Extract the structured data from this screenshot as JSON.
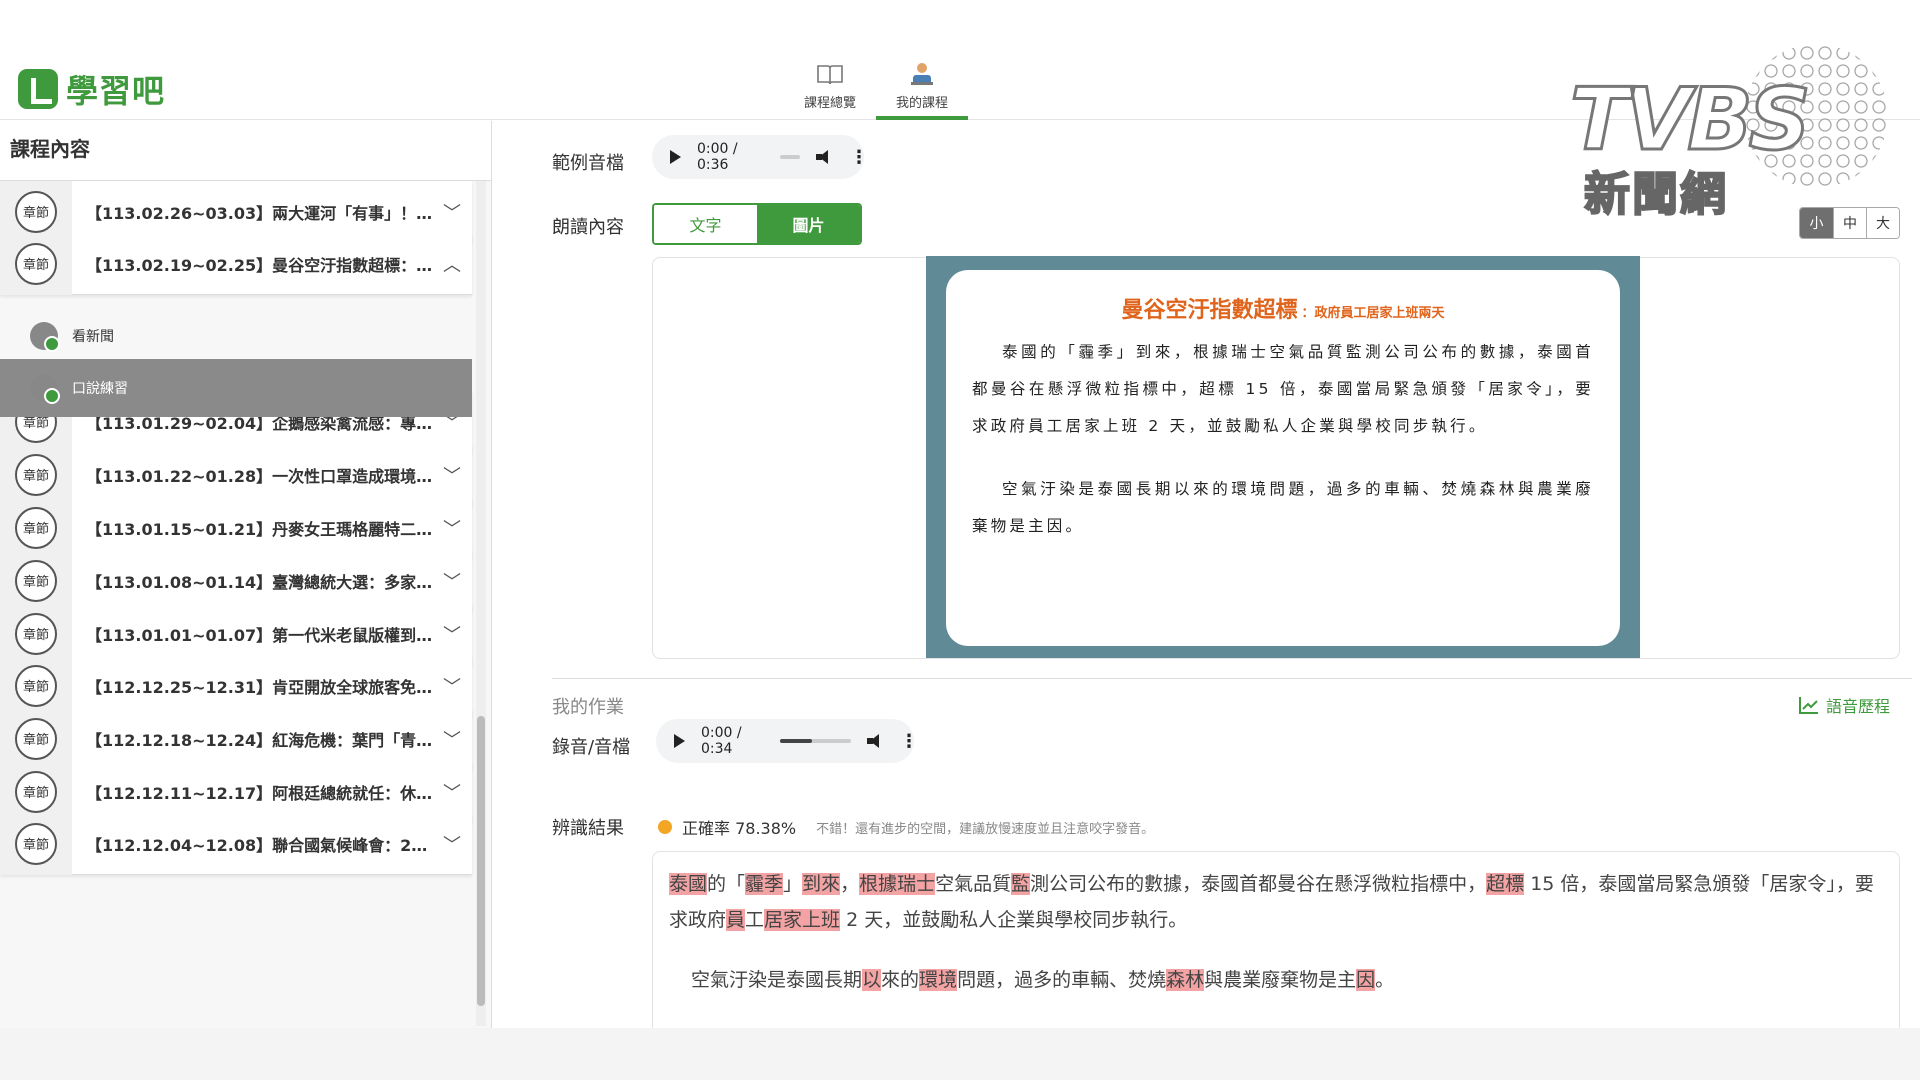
{
  "brand": {
    "logo_text": "學習吧"
  },
  "nav": {
    "tabs": [
      {
        "label": "課程總覽"
      },
      {
        "label": "我的課程"
      }
    ]
  },
  "watermark": {
    "wordmark": "TVBS",
    "subtitle": "新聞網"
  },
  "sidebar": {
    "title": "課程內容",
    "chapter_tag": "章節",
    "chapters": [
      {
        "title": "【113.02.26~03.03】兩大運河「有事」！…",
        "expanded": false
      },
      {
        "title": "【113.02.19~02.25】曼谷空汙指數超標：…",
        "expanded": true
      },
      {
        "title": "【113.01.29~02.04】企鵝感染禽流感：專…",
        "expanded": false
      },
      {
        "title": "【113.01.22~01.28】一次性口罩造成環境…",
        "expanded": false
      },
      {
        "title": "【113.01.15~01.21】丹麥女王瑪格麗特二…",
        "expanded": false
      },
      {
        "title": "【113.01.08~01.14】臺灣總統大選：多家…",
        "expanded": false
      },
      {
        "title": "【113.01.01~01.07】第一代米老鼠版權到…",
        "expanded": false
      },
      {
        "title": "【112.12.25~12.31】肯亞開放全球旅客免…",
        "expanded": false
      },
      {
        "title": "【112.12.18~12.24】紅海危機：葉門「青…",
        "expanded": false
      },
      {
        "title": "【112.12.11~12.17】阿根廷總統就任：休…",
        "expanded": false
      },
      {
        "title": "【112.12.04~12.08】聯合國氣候峰會：2…",
        "expanded": false
      }
    ],
    "subitems": [
      {
        "label": "看新聞",
        "active": false
      },
      {
        "label": "口說練習",
        "active": true
      }
    ]
  },
  "sample_audio": {
    "label": "範例音檔",
    "time": "0:00 / 0:36",
    "progress": 0
  },
  "reading": {
    "label": "朗讀內容",
    "toggle": {
      "text": "文字",
      "image": "圖片",
      "selected": "圖片"
    },
    "font_sizes": [
      "小",
      "中",
      "大"
    ],
    "selected_size": "小",
    "article": {
      "title": "曼谷空汙指數超標",
      "subtitle": "：政府員工居家上班兩天",
      "paragraphs": [
        "泰國的「霾季」到來，根據瑞士空氣品質監測公司公布的數據，泰國首都曼谷在懸浮微粒指標中，超標 15 倍，泰國當局緊急頒發「居家令」，要求政府員工居家上班 2 天，並鼓勵私人企業與學校同步執行。",
        "空氣汙染是泰國長期以來的環境問題，過多的車輛、焚燒森林與農業廢棄物是主因。"
      ]
    }
  },
  "homework": {
    "title": "我的作業",
    "history_label": "語音歷程",
    "recording": {
      "label": "錄音/音檔",
      "time": "0:00 / 0:34",
      "progress": 0.45
    },
    "result": {
      "label": "辨識結果",
      "accuracy": "正確率 78.38%",
      "tip": "不錯！還有進步的空間，建議放慢速度並且注意咬字發音。",
      "paragraphs": [
        [
          {
            "t": "泰國",
            "hl": true
          },
          {
            "t": "的「",
            "hl": false
          },
          {
            "t": "霾季",
            "hl": true
          },
          {
            "t": "」",
            "hl": false
          },
          {
            "t": "到來",
            "hl": true
          },
          {
            "t": "，",
            "hl": false
          },
          {
            "t": "根據瑞士",
            "hl": true
          },
          {
            "t": "空氣品質",
            "hl": false
          },
          {
            "t": "監",
            "hl": true
          },
          {
            "t": "測公司公布的數據，泰國首都曼谷在懸浮微粒指標中，",
            "hl": false
          },
          {
            "t": "超標",
            "hl": true
          },
          {
            "t": " 15 倍，泰國當局緊急頒發「居家令」，要求政府",
            "hl": false
          },
          {
            "t": "員",
            "hl": true
          },
          {
            "t": "工",
            "hl": false
          },
          {
            "t": "居家上班",
            "hl": true
          },
          {
            "t": " 2 天，並鼓勵私人企業與學校同步執行。",
            "hl": false
          }
        ],
        [
          {
            "t": "空氣汙染是泰國長期",
            "hl": false
          },
          {
            "t": "以",
            "hl": true
          },
          {
            "t": "來的",
            "hl": false
          },
          {
            "t": "環境",
            "hl": true
          },
          {
            "t": "問題，過多的車輛、焚燒",
            "hl": false
          },
          {
            "t": "森林",
            "hl": true
          },
          {
            "t": "與農業廢棄物是主",
            "hl": false
          },
          {
            "t": "因",
            "hl": true
          },
          {
            "t": "。",
            "hl": false
          }
        ]
      ]
    }
  },
  "colors": {
    "brand_green": "#3f9a3d",
    "highlight": "#f3a3a3",
    "accent_orange": "#e0641c",
    "article_bg": "#5f8a96",
    "status_dot": "#f2a623"
  }
}
